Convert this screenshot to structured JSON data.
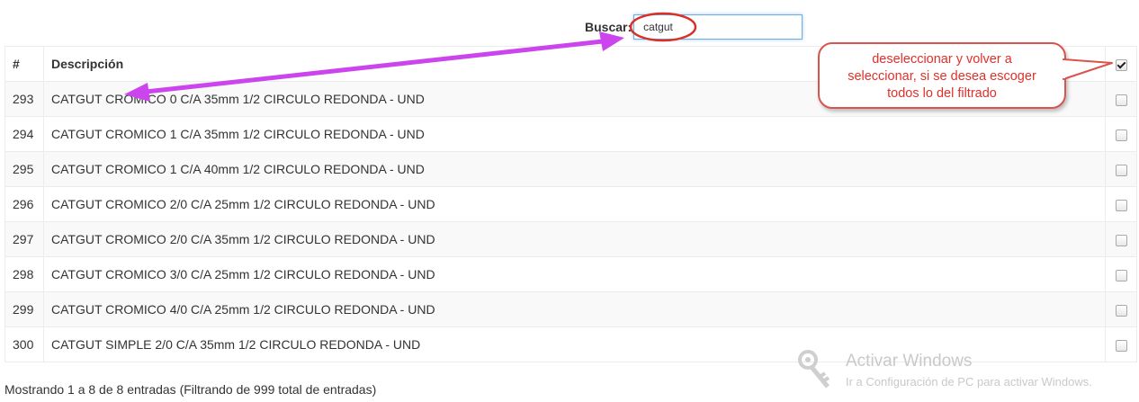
{
  "search": {
    "label": "Buscar:",
    "value": "catgut"
  },
  "table": {
    "headers": [
      "#",
      "Descripción"
    ],
    "header_checked": true,
    "rows": [
      {
        "id": "293",
        "descripcion": "CATGUT CROMICO 0 C/A 35mm 1/2 CIRCULO REDONDA - UND"
      },
      {
        "id": "294",
        "descripcion": "CATGUT CROMICO 1 C/A 35mm 1/2 CIRCULO REDONDA - UND"
      },
      {
        "id": "295",
        "descripcion": "CATGUT CROMICO 1 C/A 40mm 1/2 CIRCULO REDONDA - UND"
      },
      {
        "id": "296",
        "descripcion": "CATGUT CROMICO 2/0 C/A 25mm 1/2 CIRCULO REDONDA - UND"
      },
      {
        "id": "297",
        "descripcion": "CATGUT CROMICO 2/0 C/A 35mm 1/2 CIRCULO REDONDA - UND"
      },
      {
        "id": "298",
        "descripcion": "CATGUT CROMICO 3/0 C/A 25mm 1/2 CIRCULO REDONDA - UND"
      },
      {
        "id": "299",
        "descripcion": "CATGUT CROMICO 4/0 C/A 25mm 1/2 CIRCULO REDONDA - UND"
      },
      {
        "id": "300",
        "descripcion": "CATGUT SIMPLE 2/0 C/A 35mm 1/2 CIRCULO REDONDA - UND"
      }
    ]
  },
  "info": "Mostrando 1 a 8 de 8 entradas (Filtrando de 999 total de entradas)",
  "callout": {
    "text_line1": "deseleccionar y volver a",
    "text_line2": "seleccionar, si se desea escoger",
    "text_line3": "todos lo del filtrado"
  },
  "watermark": {
    "title": "Activar Windows",
    "subtitle": "Ir a Configuración de PC para activar Windows."
  },
  "colors": {
    "annotation_arrow": "#cc44ee",
    "annotation_circle": "#d9302a",
    "callout_text": "#e0302a",
    "search_focus_border": "#66afe9"
  },
  "icons": {
    "watermark": "key-icon",
    "checkbox": "checkbox-icon"
  }
}
